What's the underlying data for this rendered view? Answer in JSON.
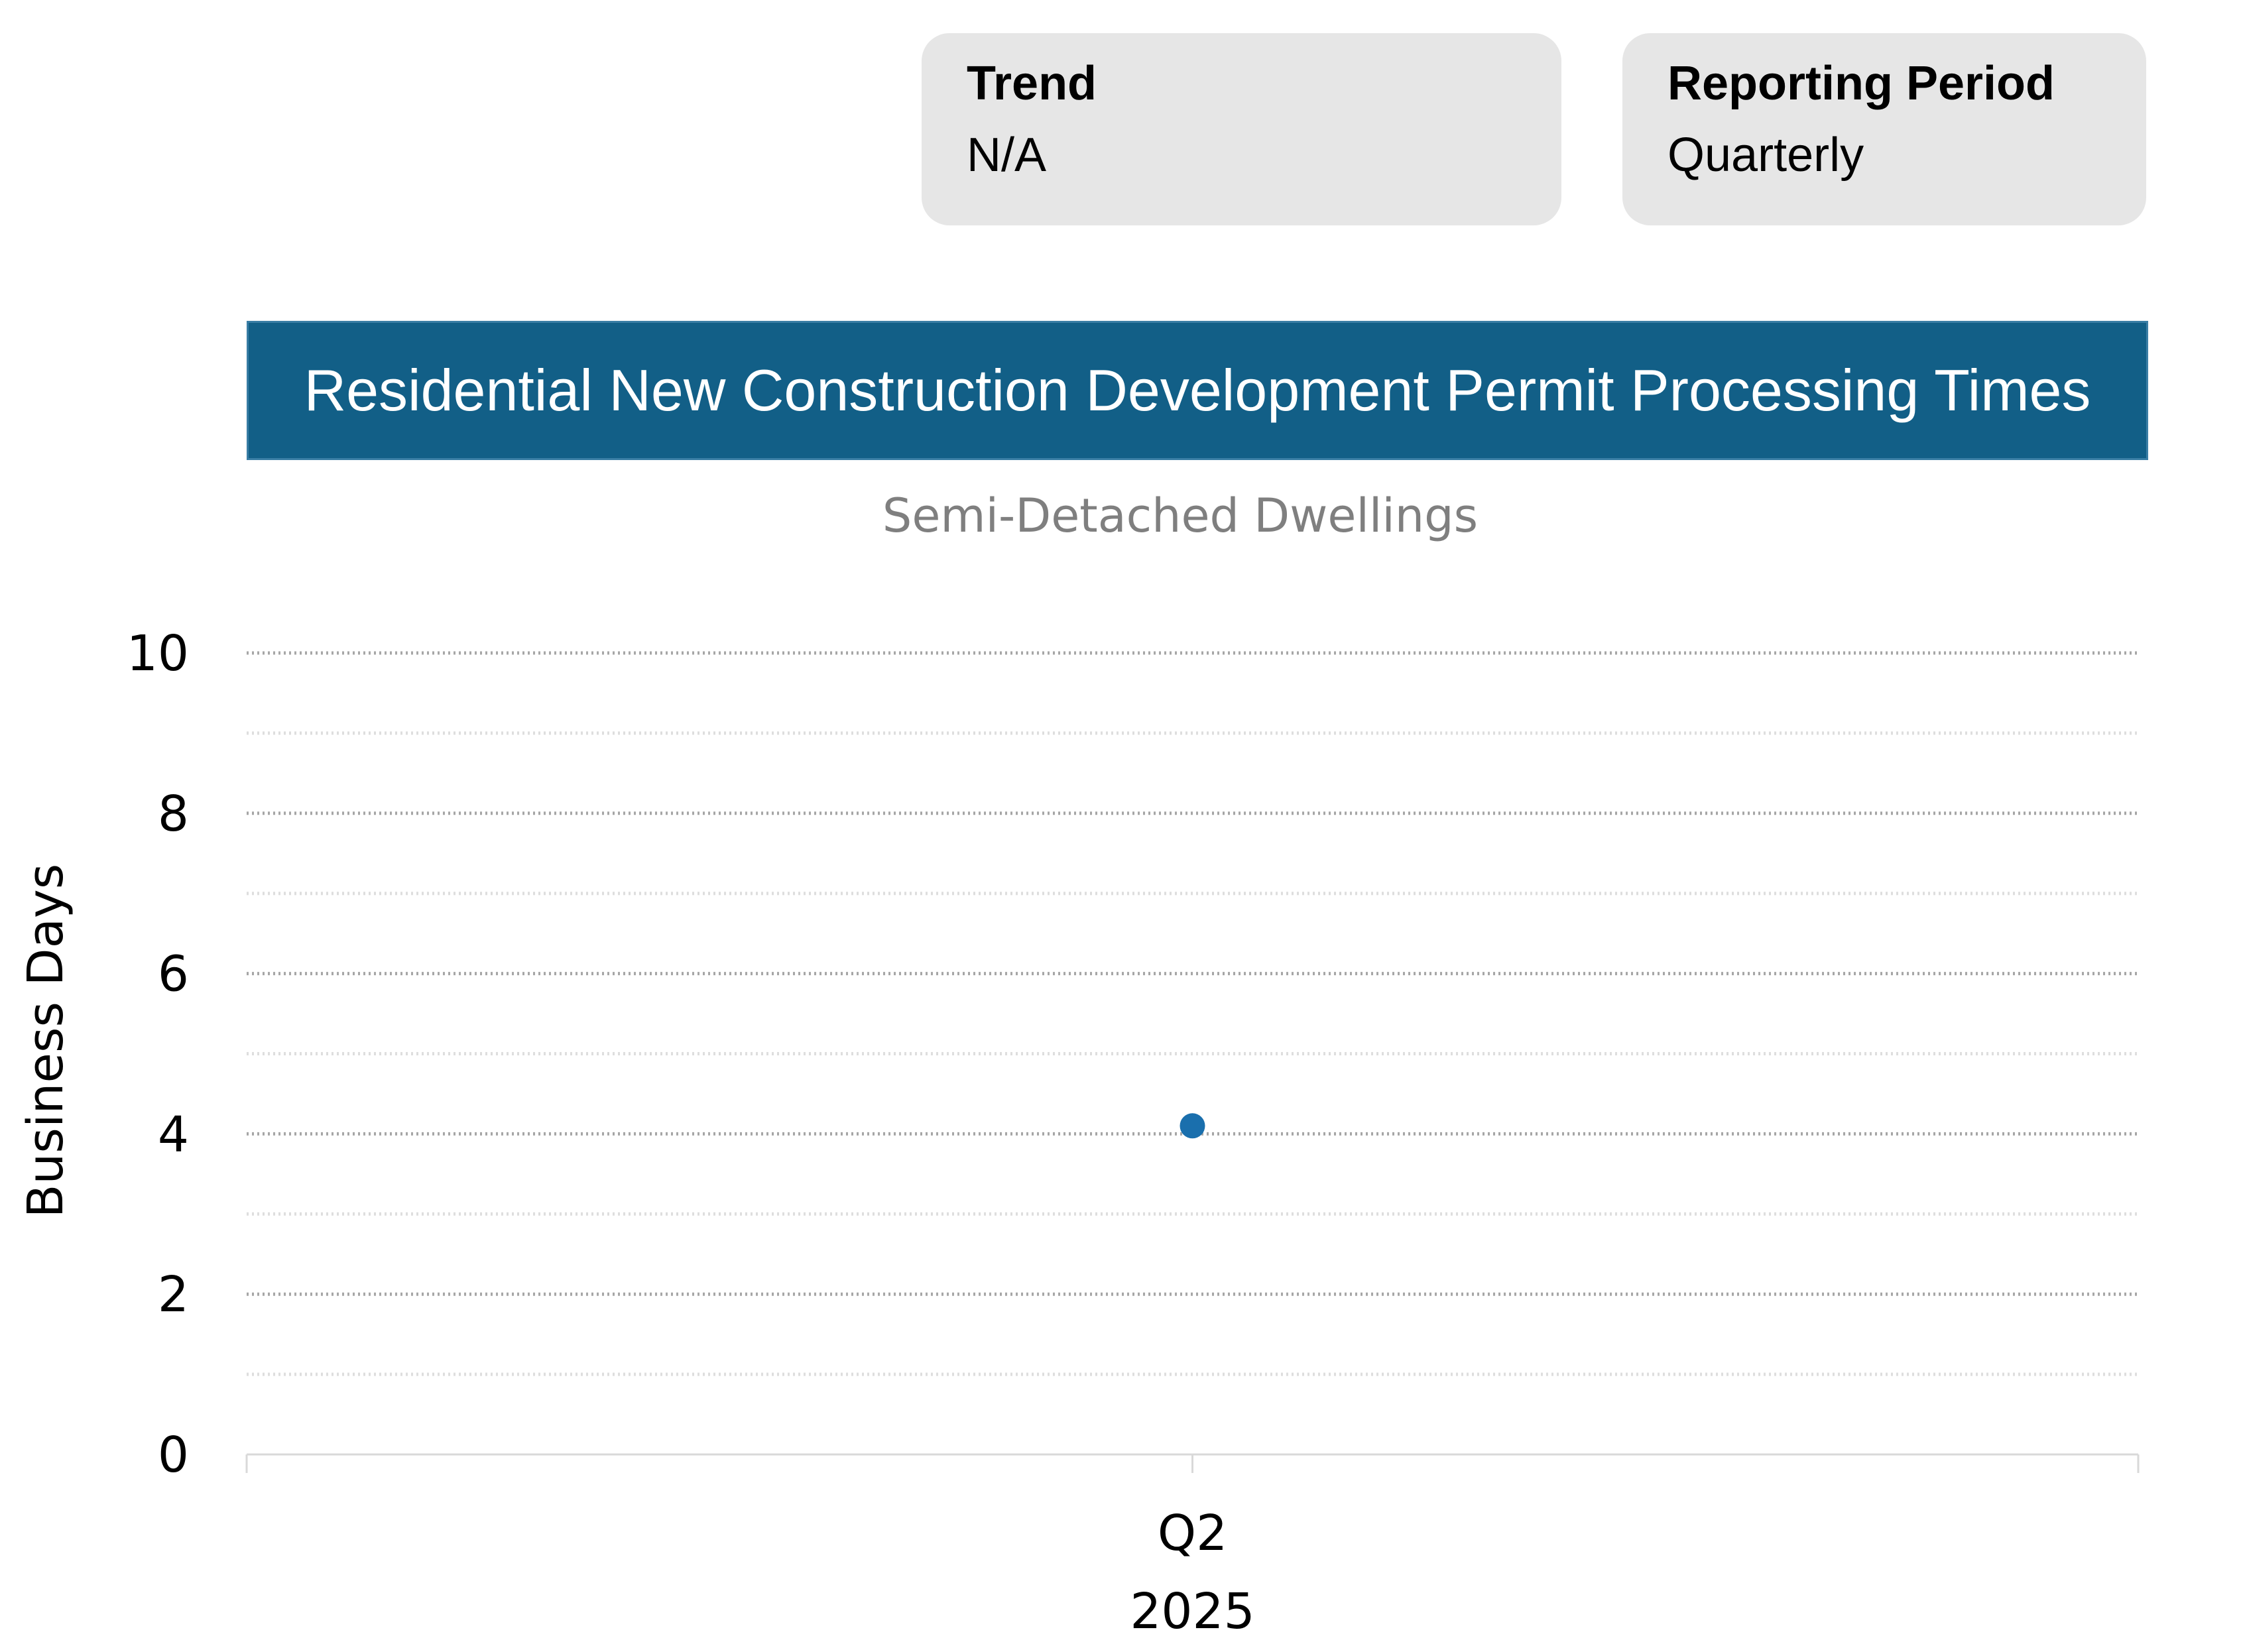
{
  "cards": {
    "trend": {
      "label": "Trend",
      "value": "N/A"
    },
    "reporting_period": {
      "label": "Reporting Period",
      "value": "Quarterly"
    }
  },
  "chart_data": {
    "type": "scatter",
    "title": "Residential New Construction Development Permit Processing Times",
    "subtitle": "Semi-Detached Dwellings",
    "xlabel": "",
    "ylabel": "Business Days",
    "categories": [
      [
        "Q2",
        "2025"
      ]
    ],
    "series": [
      {
        "values": [
          4.1
        ]
      }
    ],
    "ylim": [
      0,
      10
    ],
    "yticks": [
      0,
      2,
      4,
      6,
      8,
      10
    ],
    "grid": true,
    "legend": "none",
    "colors": {
      "marker": "#1a6fad",
      "title_bg": "#125f87",
      "subtitle": "#7f7f7f"
    }
  }
}
